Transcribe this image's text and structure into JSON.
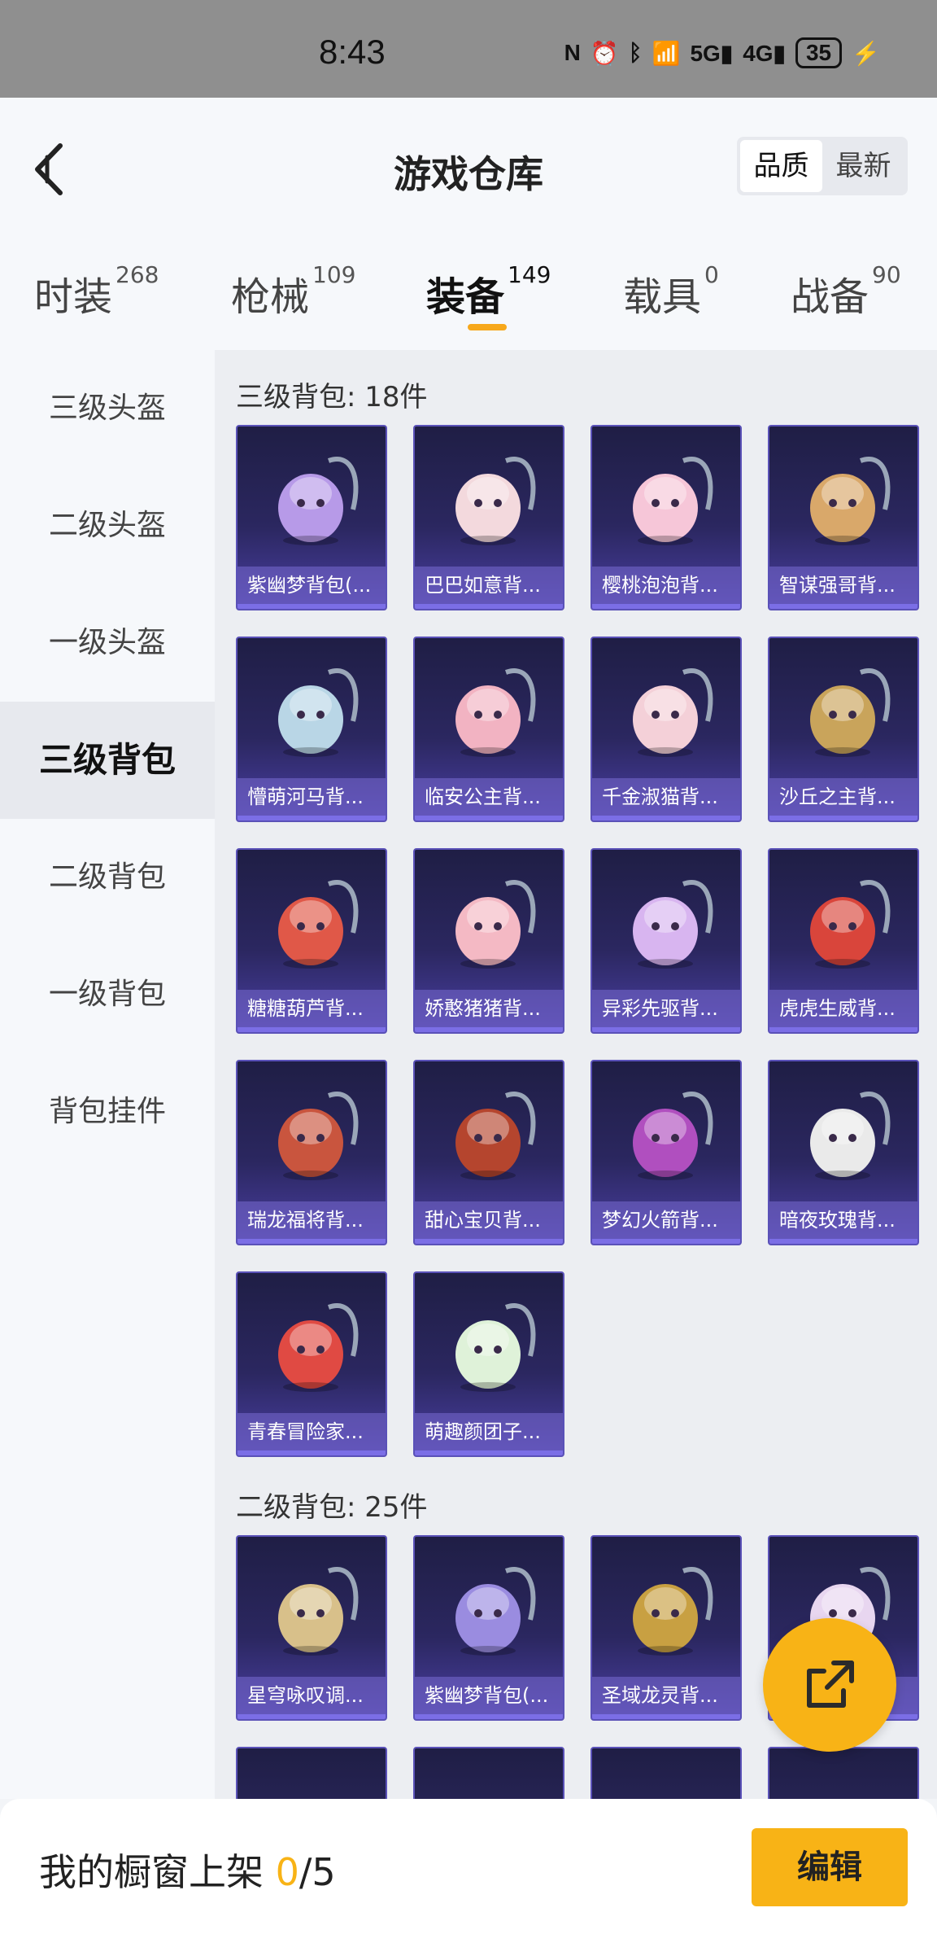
{
  "status": {
    "time": "8:43",
    "battery": "35"
  },
  "header": {
    "title": "游戏仓库",
    "sort_options": [
      "品质",
      "最新"
    ]
  },
  "tabs": [
    {
      "label": "时装",
      "count": "268"
    },
    {
      "label": "枪械",
      "count": "109"
    },
    {
      "label": "装备",
      "count": "149"
    },
    {
      "label": "载具",
      "count": "0"
    },
    {
      "label": "战备",
      "count": "90"
    }
  ],
  "sidebar": {
    "items": [
      "三级头盔",
      "二级头盔",
      "一级头盔",
      "三级背包",
      "二级背包",
      "一级背包",
      "背包挂件"
    ]
  },
  "sections": [
    {
      "title": "三级背包: 18件",
      "items": [
        "紫幽梦背包(...",
        "巴巴如意背...",
        "樱桃泡泡背...",
        "智谋强哥背...",
        "懵萌河马背...",
        "临安公主背...",
        "千金淑猫背...",
        "沙丘之主背...",
        "糖糖葫芦背...",
        "娇憨猪猪背...",
        "异彩先驱背...",
        "虎虎生威背...",
        "瑞龙福将背...",
        "甜心宝贝背...",
        "梦幻火箭背...",
        "暗夜玫瑰背...",
        "青春冒险家...",
        "萌趣颜团子..."
      ]
    },
    {
      "title": "二级背包: 25件",
      "items": [
        "星穹咏叹调...",
        "紫幽梦背包(...",
        "圣域龙灵背...",
        "..."
      ]
    }
  ],
  "bottom": {
    "prefix": "我的橱窗上架 ",
    "shelved": "0",
    "suffix": "/5",
    "edit_label": "编辑"
  }
}
